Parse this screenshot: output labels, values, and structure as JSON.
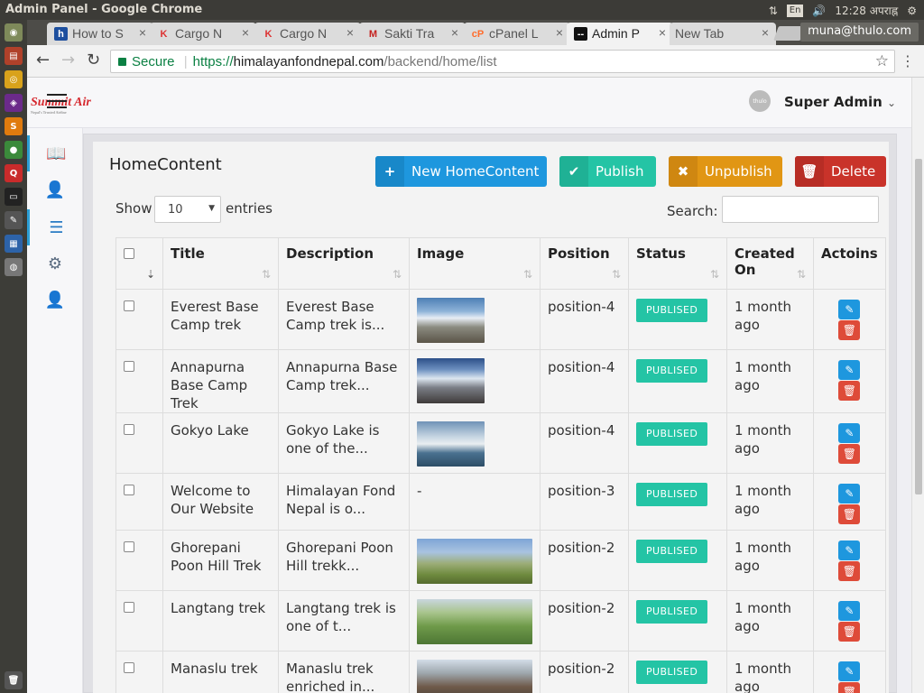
{
  "os": {
    "window_title": "Admin Panel - Google Chrome",
    "lang": "En",
    "clock": "12:28 अपराह्न"
  },
  "browser": {
    "tabs": [
      {
        "label": "How to S",
        "favicon": "h",
        "fav_color": "#1c4e9e",
        "active": false
      },
      {
        "label": "Cargo N",
        "favicon": "K",
        "fav_color": "#d33",
        "active": false
      },
      {
        "label": "Cargo N",
        "favicon": "K",
        "fav_color": "#d33",
        "active": false
      },
      {
        "label": "Sakti Tra",
        "favicon": "M",
        "fav_color": "#c5221f",
        "active": false
      },
      {
        "label": "cPanel L",
        "favicon": "cP",
        "fav_color": "#ff6c2c",
        "active": false
      },
      {
        "label": "Admin P",
        "favicon": "--",
        "fav_color": "#111",
        "active": true
      },
      {
        "label": "New Tab",
        "favicon": "",
        "fav_color": "",
        "active": false
      }
    ],
    "profile": "muna@thulo.com",
    "secure_label": "Secure",
    "url_scheme": "https://",
    "url_host": "himalayanfondnepal.com",
    "url_path": "/backend/home/list"
  },
  "header": {
    "logo_text": "Summit Air",
    "logo_tagline": "Nepal's Trusted Airline",
    "avatar_text": "thulo",
    "user_name": "Super Admin"
  },
  "sidebar": {
    "icons": [
      "book-icon",
      "user-icon",
      "list-icon",
      "gear-icon",
      "user-icon"
    ]
  },
  "main": {
    "title": "HomeContent",
    "buttons": {
      "new": "New HomeContent",
      "publish": "Publish",
      "unpublish": "Unpublish",
      "delete": "Delete"
    },
    "show_label": "Show",
    "entries_value": "10",
    "entries_label": "entries",
    "search_label": "Search:",
    "columns": [
      "Title",
      "Description",
      "Image",
      "Position",
      "Status",
      "Created On",
      "Actoins"
    ],
    "rows": [
      {
        "title": "Everest Base Camp trek",
        "description": "Everest Base Camp trek is...",
        "image": "mountain-rocks",
        "position": "position-4",
        "status": "PUBLISED",
        "created": "1 month ago"
      },
      {
        "title": "Annapurna Base Camp Trek",
        "description": "Annapurna Base Camp trek...",
        "image": "mountain-snow",
        "position": "position-4",
        "status": "PUBLISED",
        "created": "1 month ago"
      },
      {
        "title": "Gokyo Lake",
        "description": "Gokyo Lake is one of the...",
        "image": "lake",
        "position": "position-4",
        "status": "PUBLISED",
        "created": "1 month ago"
      },
      {
        "title": "Welcome to Our Website",
        "description": "Himalayan Fond Nepal is o...",
        "image": "",
        "image_text": "-",
        "position": "position-3",
        "status": "PUBLISED",
        "created": "1 month ago"
      },
      {
        "title": "Ghorepani Poon Hill Trek",
        "description": "Ghorepani Poon Hill trekk...",
        "image": "hikers",
        "position": "position-2",
        "status": "PUBLISED",
        "created": "1 month ago"
      },
      {
        "title": "Langtang trek",
        "description": "Langtang trek is one of t...",
        "image": "green-hills",
        "position": "position-2",
        "status": "PUBLISED",
        "created": "1 month ago"
      },
      {
        "title": "Manaslu trek",
        "description": "Manaslu trek enriched in...",
        "image": "valley",
        "position": "position-2",
        "status": "PUBLISED",
        "created": "1 month ago"
      }
    ]
  },
  "colors": {
    "new": "#1e97de",
    "publish": "#24c4a5",
    "unpublish": "#e19614",
    "delete": "#c9332a",
    "badge": "#24c4a5"
  }
}
